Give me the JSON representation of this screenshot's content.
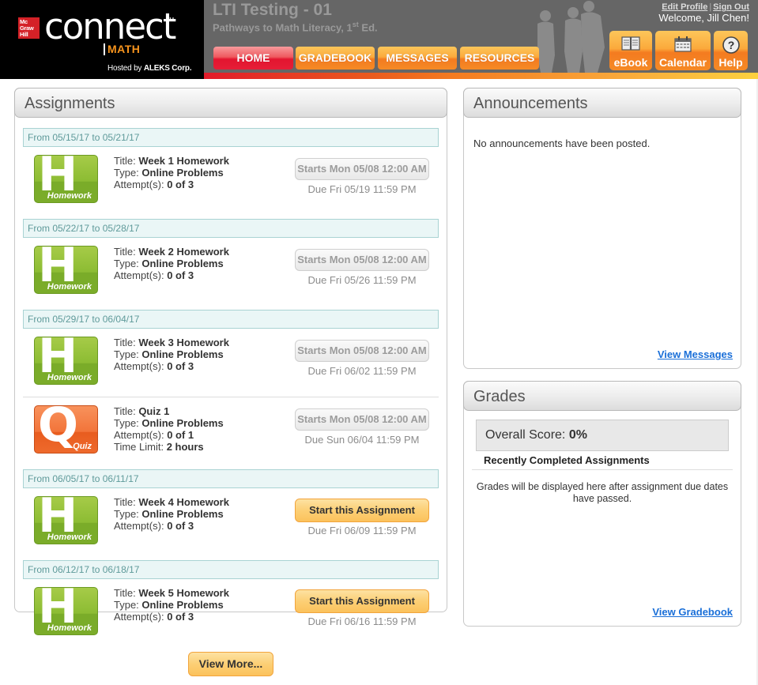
{
  "header": {
    "logo": {
      "publisher": "Mc Graw Hill",
      "product": "connect",
      "trademark": "TM",
      "subject": "MATH",
      "hosted_prefix": "Hosted by ",
      "hosted_by": "ALEKS Corp."
    },
    "course_title": "LTI Testing - 01",
    "course_subtitle": "Pathways to Math Literacy, 1",
    "course_subtitle_sup": "st",
    "course_subtitle_suffix": " Ed.",
    "edit_profile": "Edit Profile",
    "link_separator": "|",
    "sign_out": "Sign Out",
    "welcome": "Welcome, Jill Chen!",
    "nav": [
      {
        "label": "HOME",
        "active": true
      },
      {
        "label": "GRADEBOOK",
        "active": false
      },
      {
        "label": "MESSAGES",
        "active": false
      },
      {
        "label": "RESOURCES",
        "active": false
      }
    ],
    "tools": [
      {
        "label": "eBook",
        "icon": "book-icon"
      },
      {
        "label": "Calendar",
        "icon": "calendar-icon"
      },
      {
        "label": "Help",
        "icon": "help-icon"
      }
    ],
    "colors": {
      "header_bg": "#666666",
      "nav_orange": "#f47b20",
      "nav_red": "#e3152f"
    }
  },
  "assignments": {
    "title": "Assignments",
    "weeks": [
      {
        "range": "From 05/15/17 to 05/21/17"
      },
      {
        "range": "From 05/22/17 to 05/28/17"
      },
      {
        "range": "From 05/29/17 to 06/04/17"
      },
      {
        "range": "From 06/05/17 to 06/11/17"
      },
      {
        "range": "From 06/12/17 to 06/18/17"
      }
    ],
    "labels": {
      "title": "Title: ",
      "type": "Type: ",
      "attempts": "Attempt(s): ",
      "time_limit": "Time Limit: "
    },
    "items": [
      {
        "kind": "Homework",
        "letter": "H",
        "title": "Week 1 Homework",
        "type": "Online Problems",
        "attempts": "0 of 3",
        "button": "Starts Mon 05/08 12:00 AM",
        "due": "Due Fri 05/19 11:59 PM"
      },
      {
        "kind": "Homework",
        "letter": "H",
        "title": "Week 2 Homework",
        "type": "Online Problems",
        "attempts": "0 of 3",
        "button": "Starts Mon 05/08 12:00 AM",
        "due": "Due Fri 05/26 11:59 PM"
      },
      {
        "kind": "Homework",
        "letter": "H",
        "title": "Week 3 Homework",
        "type": "Online Problems",
        "attempts": "0 of 3",
        "button": "Starts Mon 05/08 12:00 AM",
        "due": "Due Fri 06/02 11:59 PM"
      },
      {
        "kind": "Quiz",
        "letter": "Q",
        "title": "Quiz 1",
        "type": "Online Problems",
        "attempts": "0 of 1",
        "time_limit": "2 hours",
        "button": "Starts Mon 05/08 12:00 AM",
        "due": "Due Sun 06/04 11:59 PM"
      },
      {
        "kind": "Homework",
        "letter": "H",
        "title": "Week 4 Homework",
        "type": "Online Problems",
        "attempts": "0 of 3",
        "button": "Start this Assignment",
        "due": "Due Fri 06/09 11:59 PM"
      },
      {
        "kind": "Homework",
        "letter": "H",
        "title": "Week 5 Homework",
        "type": "Online Problems",
        "attempts": "0 of 3",
        "button": "Start this Assignment",
        "due": "Due Fri 06/16 11:59 PM"
      }
    ],
    "view_more": "View More..."
  },
  "announcements": {
    "title": "Announcements",
    "empty_text": "No announcements have been posted.",
    "view_messages": "View Messages"
  },
  "grades": {
    "title": "Grades",
    "overall_label": "Overall Score: ",
    "overall_value": "0%",
    "recent_heading": "Recently Completed Assignments",
    "note": "Grades will be displayed here after assignment due dates have passed.",
    "view_gradebook": "View Gradebook"
  }
}
